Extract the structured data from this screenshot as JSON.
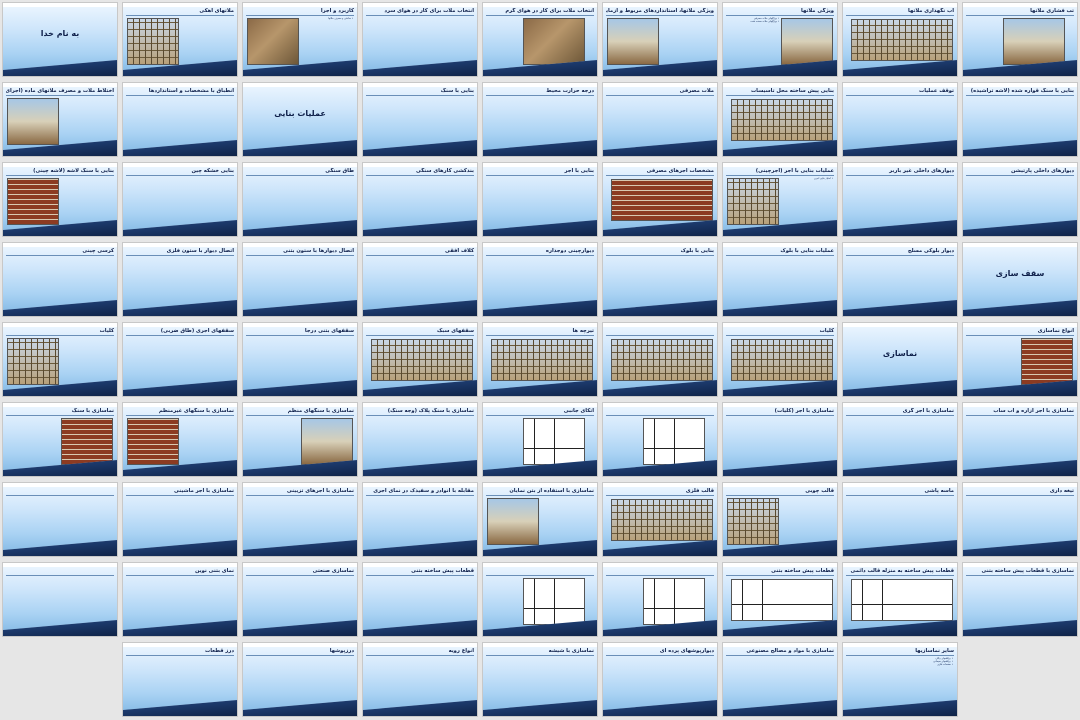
{
  "header_caption": "",
  "slides": [
    {
      "title": "تب فشاری ملاتها",
      "body": "",
      "layout": "center-photo",
      "photo": "sky"
    },
    {
      "title": "آب نگهداری ملاتها",
      "body": "",
      "layout": "wide-photo",
      "photo": "scaffold"
    },
    {
      "title": "ویژگی ملاتها",
      "body": "• ویژگیهای ملات مصرفی\n• ویژگیهای ملات سخت شده",
      "layout": "split-right",
      "photo": "sky"
    },
    {
      "title": "ویژگی ملاتها، استانداردهای مربوط و آزمایش آنها",
      "body": "",
      "layout": "split",
      "photo": "sky"
    },
    {
      "title": "انتخاب ملات برای کار در هوای گرم",
      "body": "",
      "layout": "center-photo",
      "photo": "default"
    },
    {
      "title": "انتخاب ملات برای کار در هوای سرد",
      "body": "",
      "layout": "default",
      "photo": ""
    },
    {
      "title": "کاربرد و اجرا",
      "body": "• ساختن و مصرف ملاتها",
      "layout": "split",
      "photo": "default"
    },
    {
      "title": "ملاتهای آهکی",
      "body": "",
      "layout": "split",
      "photo": "scaffold"
    },
    {
      "title": "به نام خدا",
      "body": "مشخصات فنی عمومی کارهای ساختمانی",
      "layout": "bigtitle",
      "photo": ""
    },
    {
      "title": "بنایی با سنگ قواره شده (لاشه تراشیده)",
      "body": "",
      "layout": "default",
      "photo": ""
    },
    {
      "title": "توقف عملیات",
      "body": "",
      "layout": "default",
      "photo": ""
    },
    {
      "title": "بنایی پیش ساخته محل تاسیسات",
      "body": "",
      "layout": "wide-photo",
      "photo": "scaffold"
    },
    {
      "title": "ملات مصرفی",
      "body": "",
      "layout": "default",
      "photo": ""
    },
    {
      "title": "درجه حرارت محیط",
      "body": "",
      "layout": "default",
      "photo": ""
    },
    {
      "title": "بنایی با سنگ",
      "body": "",
      "layout": "default",
      "photo": ""
    },
    {
      "title": "عملیات بنایی",
      "body": "",
      "layout": "bigtitle",
      "photo": ""
    },
    {
      "title": "انطباق با مشخصات و استانداردها",
      "body": "",
      "layout": "default",
      "photo": ""
    },
    {
      "title": "اختلاط ملات و مصرف ملاتهای ماده (اجرای ملاتها)",
      "body": "",
      "layout": "split",
      "photo": "sky"
    },
    {
      "title": "دیوارهای داخلی پارتیشن",
      "body": "",
      "layout": "default",
      "photo": ""
    },
    {
      "title": "دیوارهای داخلی غیر باربر",
      "body": "",
      "layout": "default",
      "photo": ""
    },
    {
      "title": "عملیات بنایی با آجر (آجرچینی)",
      "body": "• امتیاز بنایی آجری",
      "layout": "split",
      "photo": "scaffold"
    },
    {
      "title": "مشخصات آجرهای مصرفی",
      "body": "",
      "layout": "wide-photo",
      "photo": "brick"
    },
    {
      "title": "بنایی با آجر",
      "body": "",
      "layout": "default",
      "photo": ""
    },
    {
      "title": "بندکشی کارهای سنگی",
      "body": "",
      "layout": "default",
      "photo": ""
    },
    {
      "title": "طاق سنگی",
      "body": "",
      "layout": "default",
      "photo": ""
    },
    {
      "title": "بنایی خشکه چین",
      "body": "",
      "layout": "default",
      "photo": ""
    },
    {
      "title": "بنایی با سنگ لاشه (لاشه چینی)",
      "body": "",
      "layout": "split",
      "photo": "brick"
    },
    {
      "title": "سقف سازی",
      "body": "",
      "layout": "bigtitle",
      "photo": ""
    },
    {
      "title": "دیوار بلوکی مسلح",
      "body": "",
      "layout": "default",
      "photo": ""
    },
    {
      "title": "عملیات بنایی با بلوک",
      "body": "",
      "layout": "default",
      "photo": ""
    },
    {
      "title": "بنایی با بلوک",
      "body": "",
      "layout": "default",
      "photo": ""
    },
    {
      "title": "دیوارچینی دوجداره",
      "body": "",
      "layout": "default",
      "photo": ""
    },
    {
      "title": "کلاف افقی",
      "body": "",
      "layout": "default",
      "photo": ""
    },
    {
      "title": "اتصال دیوارها با ستون بتنی",
      "body": "",
      "layout": "default",
      "photo": ""
    },
    {
      "title": "اتصال دیوار با ستون فلزی",
      "body": "",
      "layout": "default",
      "photo": ""
    },
    {
      "title": "کرسی چینی",
      "body": "",
      "layout": "default",
      "photo": ""
    },
    {
      "title": "انواع نماسازی",
      "body": "",
      "layout": "split-right",
      "photo": "brick"
    },
    {
      "title": "نماسازی",
      "body": "",
      "layout": "bigtitle",
      "photo": ""
    },
    {
      "title": "کلیات",
      "body": "",
      "layout": "wide-photo",
      "photo": "scaffold"
    },
    {
      "title": "",
      "body": "",
      "layout": "wide-photo",
      "photo": "scaffold"
    },
    {
      "title": "تیرچه ها",
      "body": "",
      "layout": "wide-photo",
      "photo": "scaffold"
    },
    {
      "title": "سقفهای سبک",
      "body": "",
      "layout": "wide-photo",
      "photo": "scaffold"
    },
    {
      "title": "سقفهای بتنی درجا",
      "body": "",
      "layout": "default",
      "photo": ""
    },
    {
      "title": "سقفهای آجری (طاق ضربی)",
      "body": "",
      "layout": "default",
      "photo": ""
    },
    {
      "title": "کلیات",
      "body": "",
      "layout": "split",
      "photo": "scaffold"
    },
    {
      "title": "نماسازی با آجر ازاره و آب ساب",
      "body": "",
      "layout": "default",
      "photo": ""
    },
    {
      "title": "نماسازی با آجر گری",
      "body": "",
      "layout": "default",
      "photo": ""
    },
    {
      "title": "نماسازی با آجر (کلیات)",
      "body": "",
      "layout": "default",
      "photo": ""
    },
    {
      "title": "",
      "body": "",
      "layout": "center-photo",
      "photo": "diagram"
    },
    {
      "title": "اتکای جانبی",
      "body": "",
      "layout": "center-photo",
      "photo": "diagram"
    },
    {
      "title": "نماسازی با سنگ پلاک (وجه سنگ)",
      "body": "",
      "layout": "default",
      "photo": ""
    },
    {
      "title": "نماسازی با سنگهای منظم",
      "body": "",
      "layout": "split-right",
      "photo": "sky"
    },
    {
      "title": "نماسازی با سنگهای غیرمنظم",
      "body": "",
      "layout": "split",
      "photo": "brick"
    },
    {
      "title": "نماسازی با سنگ",
      "body": "",
      "layout": "split-right",
      "photo": "brick"
    },
    {
      "title": "تیغه داری",
      "body": "",
      "layout": "default",
      "photo": ""
    },
    {
      "title": "ماسه پاشی",
      "body": "",
      "layout": "default",
      "photo": ""
    },
    {
      "title": "قالب چوبی",
      "body": "",
      "layout": "split",
      "photo": "scaffold"
    },
    {
      "title": "قالب فلزی",
      "body": "",
      "layout": "wide-photo",
      "photo": "scaffold"
    },
    {
      "title": "نماسازی با استفاده از بتن نمایان",
      "body": "",
      "layout": "split",
      "photo": "sky"
    },
    {
      "title": "مقابله با انوادر و سفیدک در نمای آجری",
      "body": "",
      "layout": "default",
      "photo": ""
    },
    {
      "title": "نماسازی با آجرهای تزیینی",
      "body": "",
      "layout": "default",
      "photo": ""
    },
    {
      "title": "نماسازی با آجر ماشینی",
      "body": "",
      "layout": "default",
      "photo": ""
    },
    {
      "title": "",
      "body": "",
      "layout": "default",
      "photo": ""
    },
    {
      "title": "نماسازی با قطعات پیش ساخته بتنی",
      "body": "",
      "layout": "default",
      "photo": ""
    },
    {
      "title": "قطعات پیش ساخته به منزله قالب دائمی",
      "body": "",
      "layout": "wide-photo",
      "photo": "diagram"
    },
    {
      "title": "قطعات پیش ساخته بتنی",
      "body": "",
      "layout": "wide-photo",
      "photo": "diagram"
    },
    {
      "title": "",
      "body": "",
      "layout": "center-photo",
      "photo": "diagram"
    },
    {
      "title": "",
      "body": "",
      "layout": "center-photo",
      "photo": "diagram"
    },
    {
      "title": "قطعات پیش ساخته بتنی",
      "body": "",
      "layout": "default",
      "photo": ""
    },
    {
      "title": "نماسازی صنعتی",
      "body": "",
      "layout": "default",
      "photo": ""
    },
    {
      "title": "نمای بتنی نوین",
      "body": "",
      "layout": "default",
      "photo": ""
    },
    {
      "title": "",
      "body": "",
      "layout": "default",
      "photo": ""
    },
    {
      "title": "",
      "body": "",
      "layout": "empty",
      "photo": ""
    },
    {
      "title": "سایر نماسازیها",
      "body": "• روکشهای رنگی\n• روکشهای سیمانی\n• صفحات فلزی",
      "layout": "default",
      "photo": ""
    },
    {
      "title": "نماسازی با مواد و مصالح مصنوعی",
      "body": "",
      "layout": "default",
      "photo": ""
    },
    {
      "title": "دیوارپوشهای پرده ای",
      "body": "",
      "layout": "default",
      "photo": ""
    },
    {
      "title": "نماسازی با شیشه",
      "body": "",
      "layout": "default",
      "photo": ""
    },
    {
      "title": "انواع رویه",
      "body": "",
      "layout": "default",
      "photo": ""
    },
    {
      "title": "درزپوشها",
      "body": "",
      "layout": "default",
      "photo": ""
    },
    {
      "title": "درز قطعات",
      "body": "",
      "layout": "default",
      "photo": ""
    },
    {
      "title": "",
      "body": "",
      "layout": "empty",
      "photo": ""
    }
  ]
}
